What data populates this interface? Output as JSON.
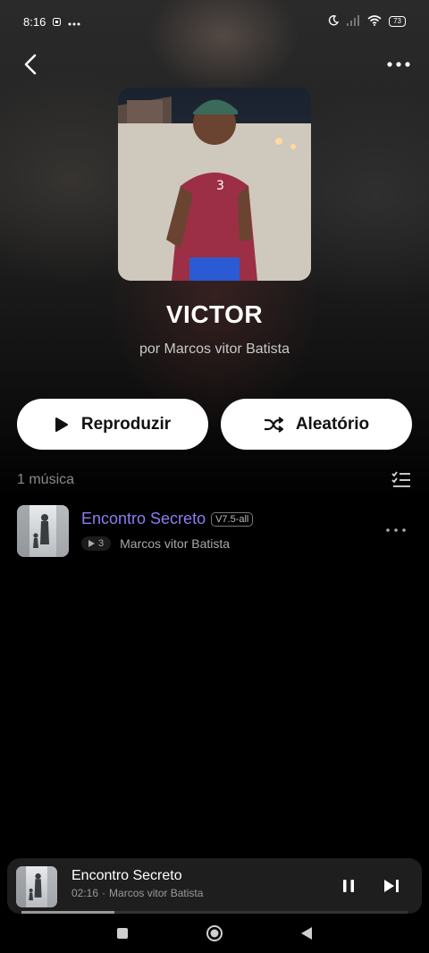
{
  "status_bar": {
    "time": "8:16",
    "battery": "73"
  },
  "playlist": {
    "title": "VICTOR",
    "subtitle": "por Marcos vitor Batista",
    "play_label": "Reproduzir",
    "shuffle_label": "Aleatório",
    "track_count": "1 música"
  },
  "tracks": [
    {
      "title": "Encontro Secreto",
      "quality": "V7.5-all",
      "plays": "3",
      "artist": "Marcos vitor Batista"
    }
  ],
  "mini_player": {
    "title": "Encontro Secreto",
    "elapsed": "02:16",
    "separator": "·",
    "artist": "Marcos vitor Batista",
    "progress": 0.24
  },
  "colors": {
    "accent": "#8e7cf2",
    "background": "#000000",
    "button_bg": "#ffffff"
  }
}
